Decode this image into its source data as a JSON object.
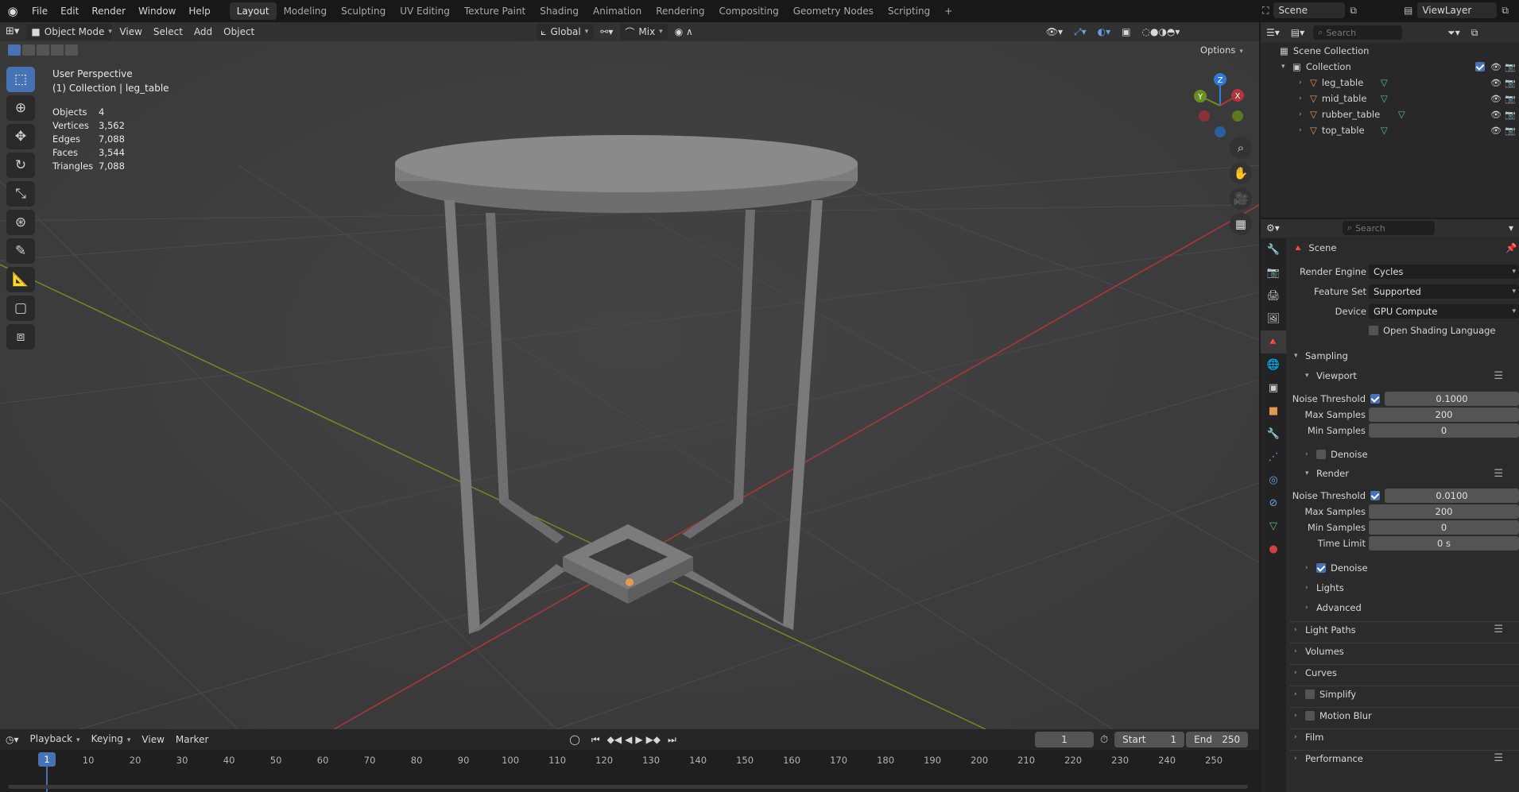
{
  "topbar": {
    "menus": [
      "File",
      "Edit",
      "Render",
      "Window",
      "Help"
    ],
    "workspaces": [
      "Layout",
      "Modeling",
      "Sculpting",
      "UV Editing",
      "Texture Paint",
      "Shading",
      "Animation",
      "Rendering",
      "Compositing",
      "Geometry Nodes",
      "Scripting"
    ],
    "active_workspace": "Layout",
    "add_tab": "+",
    "scene": "Scene",
    "view_layer": "ViewLayer"
  },
  "viewport": {
    "mode": "Object Mode",
    "menus": [
      "View",
      "Select",
      "Add",
      "Object"
    ],
    "orientation": "Global",
    "snap_mode": "Mix",
    "options_label": "Options",
    "perspective_label": "User Perspective",
    "collection_label": "(1) Collection | leg_table",
    "stats": [
      {
        "label": "Objects",
        "value": "4"
      },
      {
        "label": "Vertices",
        "value": "3,562"
      },
      {
        "label": "Edges",
        "value": "7,088"
      },
      {
        "label": "Faces",
        "value": "3,544"
      },
      {
        "label": "Triangles",
        "value": "7,088"
      }
    ],
    "gizmo_axes": [
      "Z",
      "Y",
      "X"
    ],
    "colors": {
      "x_axis": "#b0353c",
      "y_axis": "#6b8e23",
      "z_axis": "#2f7bd6",
      "active_tool": "#4772b3"
    }
  },
  "timeline": {
    "menus": [
      "Playback",
      "Keying",
      "View",
      "Marker"
    ],
    "current_frame": "1",
    "start_label": "Start",
    "start_value": "1",
    "end_label": "End",
    "end_value": "250",
    "ticks": [
      "1",
      "10",
      "20",
      "30",
      "40",
      "50",
      "60",
      "70",
      "80",
      "90",
      "100",
      "110",
      "120",
      "130",
      "140",
      "150",
      "160",
      "170",
      "180",
      "190",
      "200",
      "210",
      "220",
      "230",
      "240",
      "250"
    ]
  },
  "outliner": {
    "search_placeholder": "Search",
    "scene_collection": "Scene Collection",
    "collection": "Collection",
    "objects": [
      "leg_table",
      "mid_table",
      "rubber_table",
      "top_table"
    ]
  },
  "properties": {
    "search_placeholder": "Search",
    "context": "Scene",
    "render_engine_label": "Render Engine",
    "render_engine": "Cycles",
    "feature_set_label": "Feature Set",
    "feature_set": "Supported",
    "device_label": "Device",
    "device": "GPU Compute",
    "osl_label": "Open Shading Language",
    "sampling": "Sampling",
    "viewport": "Viewport",
    "vp_noise_label": "Noise Threshold",
    "vp_noise": "0.1000",
    "vp_max_label": "Max Samples",
    "vp_max": "200",
    "vp_min_label": "Min Samples",
    "vp_min": "0",
    "vp_denoise": "Denoise",
    "render": "Render",
    "r_noise_label": "Noise Threshold",
    "r_noise": "0.0100",
    "r_max_label": "Max Samples",
    "r_max": "200",
    "r_min_label": "Min Samples",
    "r_min": "0",
    "r_time_label": "Time Limit",
    "r_time": "0 s",
    "r_denoise": "Denoise",
    "lights": "Lights",
    "advanced": "Advanced",
    "light_paths": "Light Paths",
    "volumes": "Volumes",
    "curves": "Curves",
    "simplify": "Simplify",
    "motion_blur": "Motion Blur",
    "film": "Film",
    "performance": "Performance"
  }
}
